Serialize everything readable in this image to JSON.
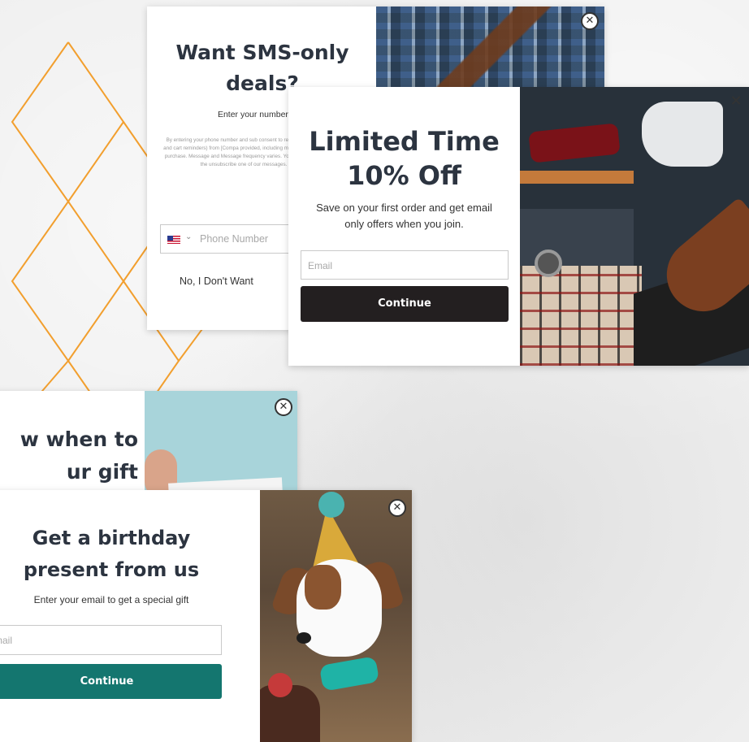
{
  "colors": {
    "background": "#efefef",
    "deco_lines": "#f29f2e",
    "heading": "#2c3440",
    "dark_button": "#231f20",
    "teal_button": "#14766f",
    "placeholder": "#a8a8a8"
  },
  "sms_popup": {
    "title": "Want SMS-only deals?",
    "subtitle": "Enter your number to get S",
    "legal": "By entering your phone number and sub consent to receive marketing text messag codes and cart reminders) from [Compa provided, including messages sent by aut condition of any purchase. Message and Message frequency varies. You can uns replying STOP or clicking the unsubscribe one of our messages. View our Privacy Po",
    "phone_placeholder": "Phone Number",
    "country_icon": "us-flag-icon",
    "dropdown_icon": "chevron-down-icon",
    "decline_label": "No, I Don't Want",
    "close_icon": "close-icon"
  },
  "limited_popup": {
    "title": "Limited Time 10% Off",
    "subtitle": "Save on your first order and get email only offers when you join.",
    "email_placeholder": "Email",
    "button_label": "Continue",
    "close_icon": "close-icon"
  },
  "gift_popup": {
    "title_line1": "w when to",
    "title_line2": "ur gift",
    "close_icon": "close-icon"
  },
  "birthday_popup": {
    "title": "Get a birthday present from us",
    "subtitle": "Enter your email to get a special gift",
    "email_placeholder": "mail",
    "button_label": "Continue",
    "close_icon": "close-icon"
  }
}
